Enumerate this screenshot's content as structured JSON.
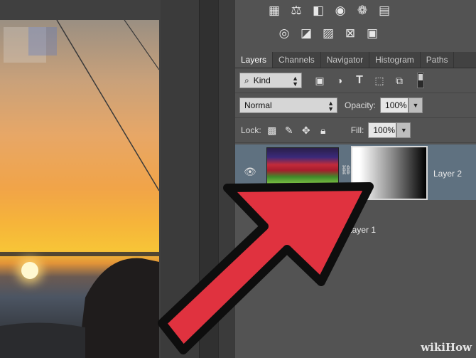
{
  "top_icons": {
    "row1": [
      "grid-icon",
      "balance-icon",
      "half-square-icon",
      "camera-icon",
      "circles-icon",
      "table-icon"
    ],
    "row2": [
      "ring-icon",
      "slash-square-icon",
      "stripe-square-icon",
      "x-square-icon",
      "gradient-square-icon"
    ]
  },
  "tabs": [
    "Layers",
    "Channels",
    "Navigator",
    "Histogram",
    "Paths"
  ],
  "filter": {
    "kind_label": "Kind"
  },
  "blend": {
    "mode": "Normal",
    "opacity_label": "Opacity:",
    "opacity": "100%"
  },
  "lock": {
    "label": "Lock:",
    "fill_label": "Fill:",
    "fill": "100%"
  },
  "layers": [
    {
      "name": "Layer 2"
    },
    {
      "name": "Layer 1"
    }
  ],
  "watermark": "wikiHow",
  "colors": {
    "arrow": "#e0323f",
    "selected_layer": "#5f7180",
    "panel": "#535353"
  }
}
